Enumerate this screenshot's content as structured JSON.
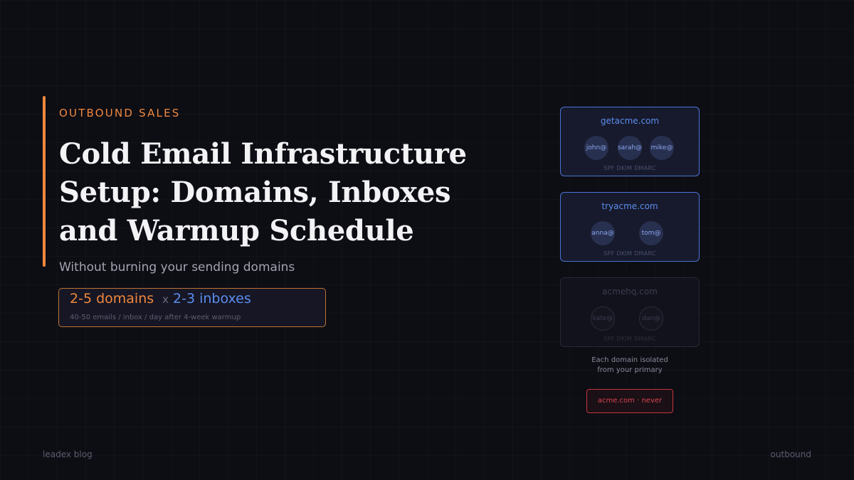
{
  "header": {
    "eyebrow": "OUTBOUND SALES",
    "title": "Cold Email Infrastructure Setup: Domains, Inboxes and Warmup Schedule",
    "subtitle": "Without burning your sending domains"
  },
  "stats": {
    "domains": "2-5 domains",
    "separator": "x",
    "inboxes": "2-3 inboxes",
    "note": "40-50 emails / inbox / day after 4-week warmup"
  },
  "domains": [
    {
      "name": "getacme.com",
      "inboxes": [
        "john@",
        "sarah@",
        "mike@"
      ],
      "auth": "SPF DKIM DMARC",
      "active": true
    },
    {
      "name": "tryacme.com",
      "inboxes": [
        "anna@",
        "tom@"
      ],
      "auth": "SPF DKIM DMARC",
      "active": true
    },
    {
      "name": "acmehq.com",
      "inboxes": [
        "kate@",
        "dan@"
      ],
      "auth": "SPF DKIM DMARC",
      "active": false
    }
  ],
  "isolation_note": [
    "Each domain isolated",
    "from your primary"
  ],
  "primary_warning": "acme.com · never",
  "footer": {
    "left": "leadex blog",
    "right": "outbound"
  },
  "colors": {
    "accent_orange": "#f0883e",
    "accent_blue": "#5b8def",
    "danger_red": "#e04450",
    "background": "#0d0d14"
  }
}
